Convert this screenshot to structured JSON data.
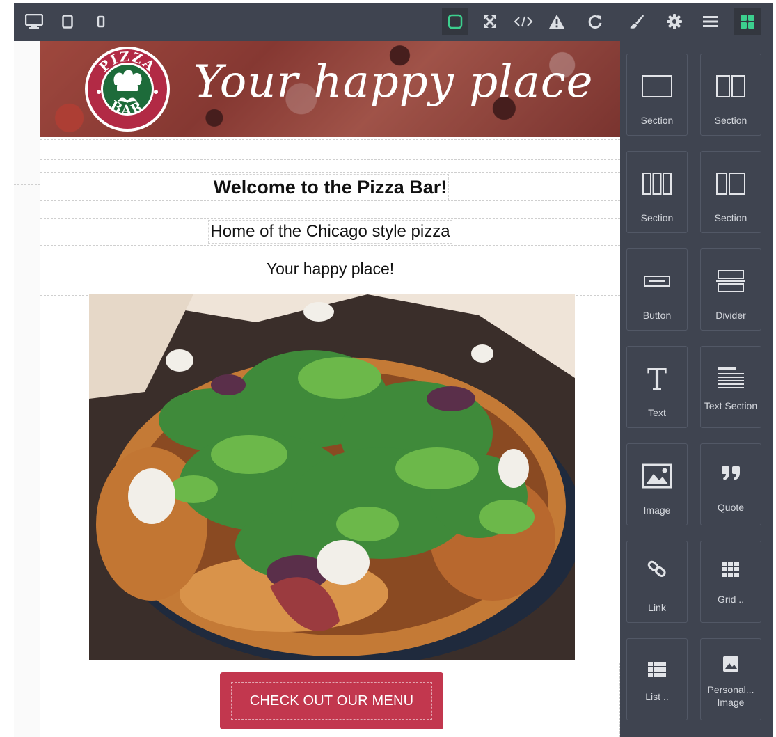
{
  "toolbar": {
    "left": [
      {
        "name": "desktop-view-icon"
      },
      {
        "name": "tablet-view-icon"
      },
      {
        "name": "mobile-view-icon"
      }
    ],
    "right": [
      {
        "name": "outline-toggle-icon",
        "active": true
      },
      {
        "name": "fullscreen-icon"
      },
      {
        "name": "code-view-icon"
      },
      {
        "name": "warning-icon"
      },
      {
        "name": "redo-icon"
      },
      {
        "name": "style-manager-icon"
      },
      {
        "name": "settings-icon"
      },
      {
        "name": "layer-manager-icon"
      },
      {
        "name": "blocks-icon",
        "active": true
      }
    ]
  },
  "email": {
    "banner": {
      "logo_top": "PIZZA",
      "logo_bottom": "BAR",
      "tagline": "Your happy place"
    },
    "welcome_title": "Welcome to the Pizza Bar!",
    "subtitle": "Home of the Chicago style pizza",
    "tagline": "Your happy place!",
    "cta_label": "CHECK OUT OUR MENU",
    "colors": {
      "cta": "#c2374e",
      "logo_ring": "#b22a45",
      "logo_green": "#1d6b3a"
    }
  },
  "blocks": [
    {
      "label": "Section",
      "icon": "section-1col-icon"
    },
    {
      "label": "Section",
      "icon": "section-2col-icon"
    },
    {
      "label": "Section",
      "icon": "section-3col-icon"
    },
    {
      "label": "Section",
      "icon": "section-2col-alt-icon"
    },
    {
      "label": "Button",
      "icon": "button-block-icon"
    },
    {
      "label": "Divider",
      "icon": "divider-block-icon"
    },
    {
      "label": "Text",
      "icon": "text-block-icon"
    },
    {
      "label": "Text Section",
      "icon": "text-section-block-icon"
    },
    {
      "label": "Image",
      "icon": "image-block-icon"
    },
    {
      "label": "Quote",
      "icon": "quote-block-icon"
    },
    {
      "label": "Link",
      "icon": "link-block-icon"
    },
    {
      "label": "Grid ..",
      "icon": "grid-block-icon"
    },
    {
      "label": "List ..",
      "icon": "list-block-icon"
    },
    {
      "label": "Personal... Image",
      "icon": "personal-image-block-icon"
    }
  ],
  "panel_colors": {
    "background": "#3f4450",
    "active_icon": "#3ccf8e"
  }
}
